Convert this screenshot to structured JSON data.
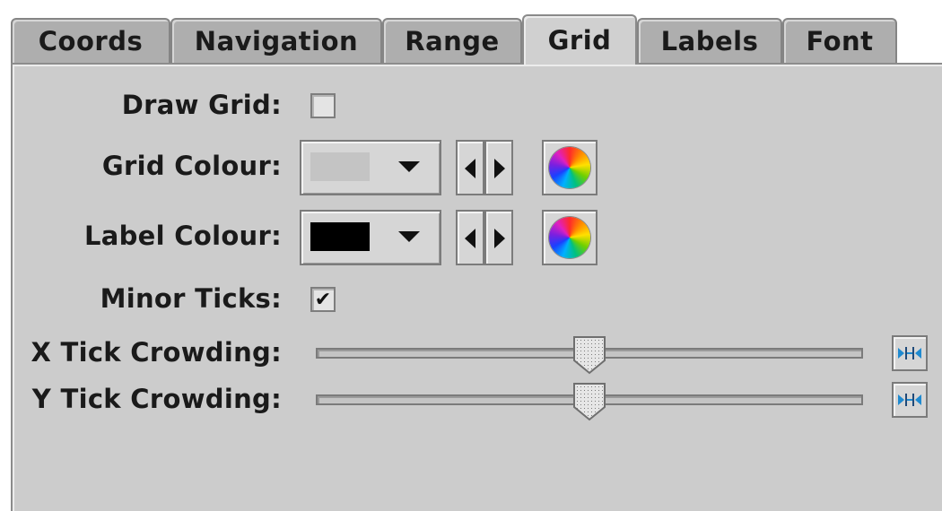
{
  "tabs": [
    "Coords",
    "Navigation",
    "Range",
    "Grid",
    "Labels",
    "Font"
  ],
  "active_tab": "Grid",
  "form": {
    "draw_grid": {
      "label": "Draw Grid:",
      "checked": false
    },
    "grid_colour": {
      "label": "Grid Colour:",
      "swatch": "#c4c4c4"
    },
    "label_colour": {
      "label": "Label Colour:",
      "swatch": "#000000"
    },
    "minor_ticks": {
      "label": "Minor Ticks:",
      "checked": true,
      "glyph": "✔"
    },
    "x_tick_crowding": {
      "label": "X Tick Crowding:",
      "value": 0.5
    },
    "y_tick_crowding": {
      "label": "Y Tick Crowding:",
      "value": 0.5
    }
  },
  "icons": {
    "combo_arrow": "chevron-down-icon",
    "step_prev": "triangle-left-icon",
    "step_next": "triangle-right-icon",
    "chooser": "colour-wheel-icon",
    "reset": "reset-slider-icon"
  },
  "colors": {
    "panel_bg": "#cccccc",
    "tab_bg": "#aeaeae",
    "active_tab_bg": "#d0d0d0",
    "reset_icon": "#1f8ad0"
  }
}
